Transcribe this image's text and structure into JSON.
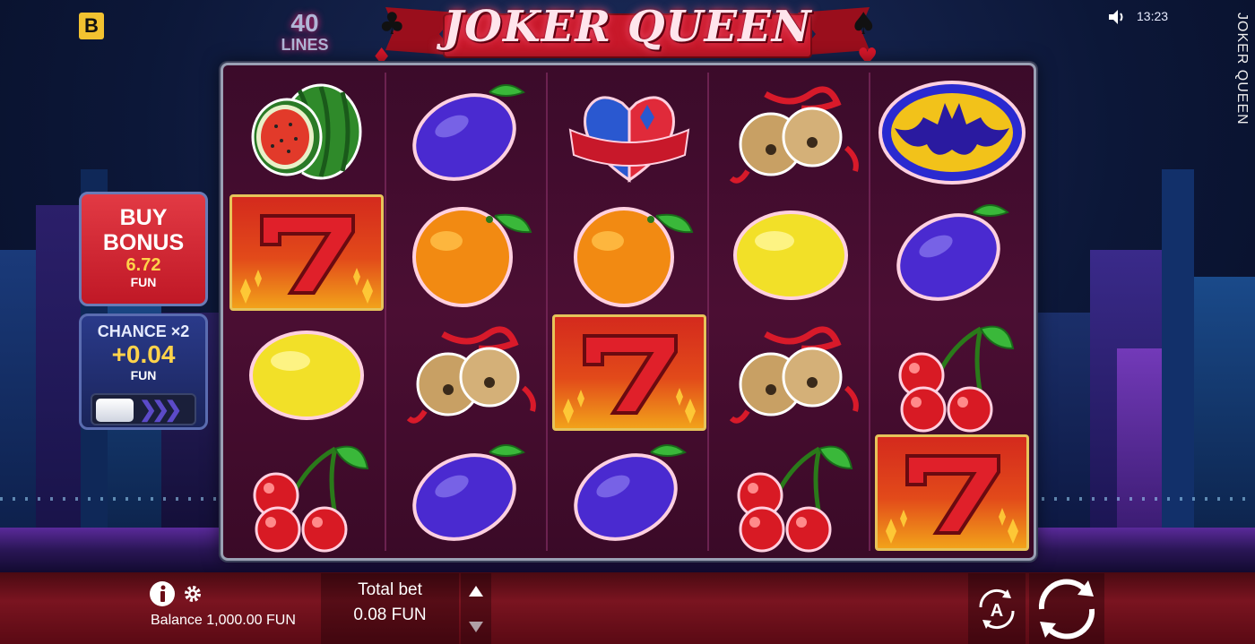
{
  "header": {
    "brand_letter": "B",
    "lines_number": "40",
    "lines_label": "LINES",
    "game_logo": "JOKER QUEEN",
    "clock": "13:23",
    "side_title": "JOKER QUEEN",
    "icons": [
      "sound-icon"
    ]
  },
  "buy_bonus": {
    "title_line1": "BUY",
    "title_line2": "BONUS",
    "price": "6.72",
    "unit": "FUN"
  },
  "chance": {
    "title": "CHANCE ×2",
    "value": "+0.04",
    "unit": "FUN"
  },
  "reels": {
    "columns": 5,
    "rows": 4,
    "grid": [
      [
        "watermelon",
        "plum",
        "heart",
        "bells",
        "bat"
      ],
      [
        "seven",
        "orange",
        "orange",
        "lemon",
        "plum"
      ],
      [
        "lemon",
        "bells",
        "seven",
        "bells",
        "cherries"
      ],
      [
        "cherries",
        "plum",
        "plum",
        "cherries",
        "seven"
      ]
    ]
  },
  "bottom_bar": {
    "balance": "Balance 1,000.00 FUN",
    "total_bet_label": "Total bet",
    "total_bet_value": "0.08 FUN",
    "icons": [
      "info-icon",
      "gear-icon",
      "arrow-up-icon",
      "arrow-down-icon",
      "autoplay-icon",
      "spin-icon"
    ]
  },
  "colors": {
    "brand": "#f2c230",
    "buy_bonus_bg": "#c01826",
    "chance_bg": "#1a245a",
    "accent_value": "#ffd34a",
    "bottom_bar": "#7a1420",
    "reels_bg": "#4b0e33"
  }
}
